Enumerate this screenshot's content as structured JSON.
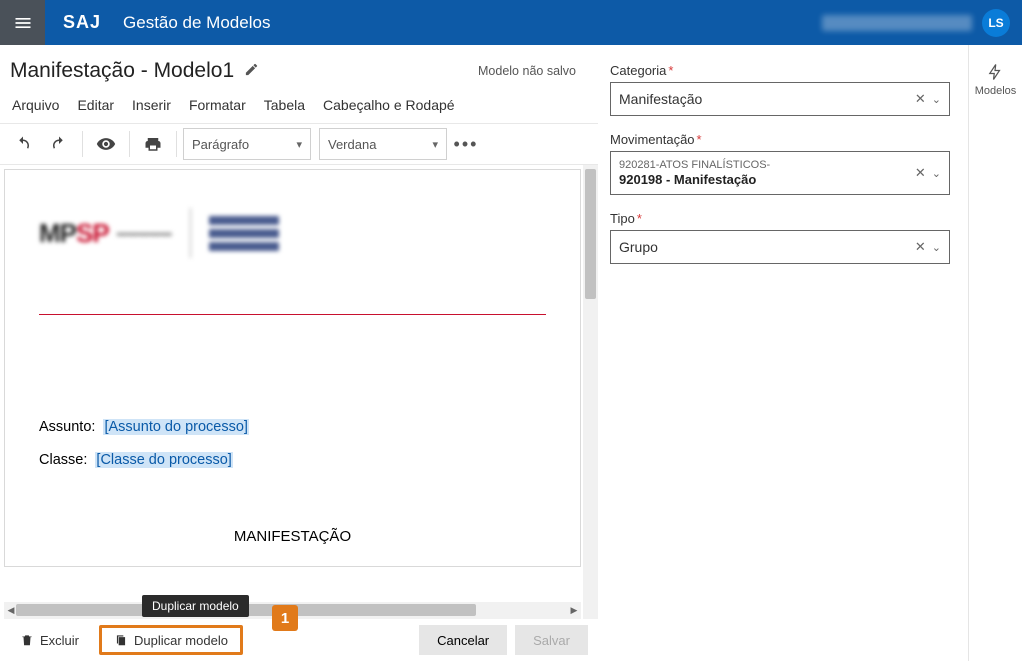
{
  "header": {
    "brand": "SAJ",
    "app_title": "Gestão de Modelos",
    "avatar_initials": "LS"
  },
  "title": {
    "text": "Manifestação - Modelo1",
    "status": "Modelo não salvo"
  },
  "menubar": {
    "arquivo": "Arquivo",
    "editar": "Editar",
    "inserir": "Inserir",
    "formatar": "Formatar",
    "tabela": "Tabela",
    "cabecalho": "Cabeçalho e Rodapé"
  },
  "toolbar": {
    "style": "Parágrafo",
    "font": "Verdana"
  },
  "document": {
    "assunto_label": "Assunto:",
    "assunto_var": "[Assunto do processo]",
    "classe_label": "Classe:",
    "classe_var": "[Classe do processo]",
    "heading": "MANIFESTAÇÃO"
  },
  "bottombar": {
    "excluir": "Excluir",
    "duplicar": "Duplicar modelo",
    "cancelar": "Cancelar",
    "salvar": "Salvar",
    "tooltip": "Duplicar modelo",
    "callout": "1"
  },
  "props": {
    "categoria": {
      "label": "Categoria",
      "value": "Manifestação"
    },
    "movimentacao": {
      "label": "Movimentação",
      "parent": "920281-ATOS FINALÍSTICOS-",
      "child": "920198 - Manifestação"
    },
    "tipo": {
      "label": "Tipo",
      "value": "Grupo"
    }
  },
  "rail": {
    "modelos": "Modelos"
  }
}
